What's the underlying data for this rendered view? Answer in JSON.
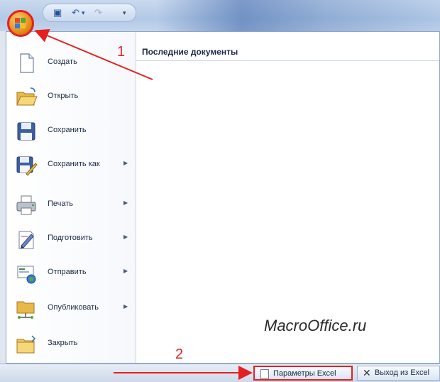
{
  "menu": {
    "items": [
      {
        "label": "Создать",
        "icon": "new-document-icon",
        "has_submenu": false
      },
      {
        "label": "Открыть",
        "icon": "open-folder-icon",
        "has_submenu": false
      },
      {
        "label": "Сохранить",
        "icon": "save-disk-icon",
        "has_submenu": false
      },
      {
        "label": "Сохранить как",
        "icon": "save-as-icon",
        "has_submenu": true
      },
      {
        "label": "Печать",
        "icon": "printer-icon",
        "has_submenu": true
      },
      {
        "label": "Подготовить",
        "icon": "prepare-icon",
        "has_submenu": true
      },
      {
        "label": "Отправить",
        "icon": "send-icon",
        "has_submenu": true
      },
      {
        "label": "Опубликовать",
        "icon": "publish-icon",
        "has_submenu": true
      },
      {
        "label": "Закрыть",
        "icon": "close-folder-icon",
        "has_submenu": false
      }
    ],
    "submenu_arrow": "▶"
  },
  "recent": {
    "title": "Последние документы"
  },
  "footer": {
    "params_label": "Параметры Excel",
    "exit_label": "Выход из Excel"
  },
  "watermark": "MacroOffice.ru",
  "annotations": {
    "step1": "1",
    "step2": "2",
    "color": "#e52020"
  },
  "qat": {
    "save_icon": "save-icon",
    "undo_icon": "undo-icon",
    "redo_icon": "redo-icon"
  }
}
